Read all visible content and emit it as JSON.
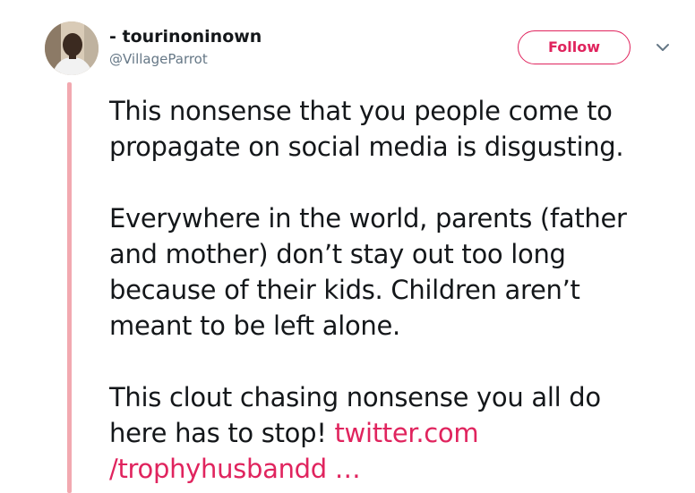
{
  "tweet": {
    "display_name": "- tourinoninown",
    "handle": "@VillageParrot",
    "follow_label": "Follow",
    "caret_icon": "chevron-down-icon",
    "accent_color": "#e0245e",
    "thread_line_color": "#f2a9b0",
    "paragraphs": [
      {
        "lines": [
          "This nonsense that you people come to",
          "propagate on social media is disgusting."
        ]
      },
      {
        "lines": [
          "Everywhere in the world, parents (father",
          "and mother) don’t stay out too long",
          "because of their kids. Children aren’t",
          "meant to be left alone."
        ]
      },
      {
        "lines": [
          "This clout chasing nonsense you all do"
        ],
        "last_line_text": "here has to stop! ",
        "link_line1": "twitter.com",
        "link_line2": "/trophyhusbandd …"
      }
    ]
  }
}
